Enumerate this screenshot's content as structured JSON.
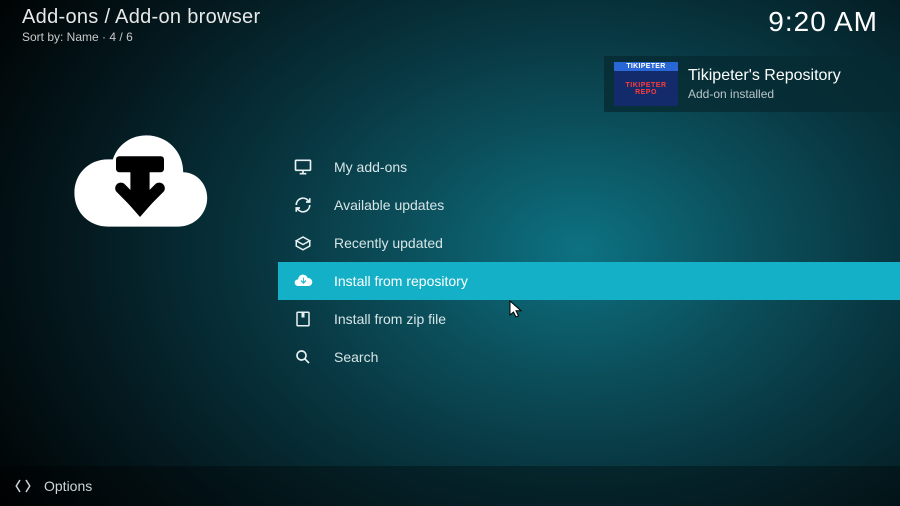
{
  "header": {
    "breadcrumb": "Add-ons / Add-on browser",
    "sort_label": "Sort by: Name",
    "position": "4 / 6",
    "clock": "9:20 AM"
  },
  "toast": {
    "title": "Tikipeter's Repository",
    "subtitle": "Add-on installed",
    "thumb_top": "TIKIPETER",
    "thumb_main": "TIKIPETER REPO"
  },
  "menu": {
    "items": [
      {
        "icon": "screen-icon",
        "label": "My add-ons",
        "selected": false
      },
      {
        "icon": "refresh-icon",
        "label": "Available updates",
        "selected": false
      },
      {
        "icon": "box-open-icon",
        "label": "Recently updated",
        "selected": false
      },
      {
        "icon": "cloud-download-icon",
        "label": "Install from repository",
        "selected": true
      },
      {
        "icon": "zip-file-icon",
        "label": "Install from zip file",
        "selected": false
      },
      {
        "icon": "search-icon",
        "label": "Search",
        "selected": false
      }
    ]
  },
  "footer": {
    "options_label": "Options"
  },
  "colors": {
    "accent": "#14b0c7"
  }
}
